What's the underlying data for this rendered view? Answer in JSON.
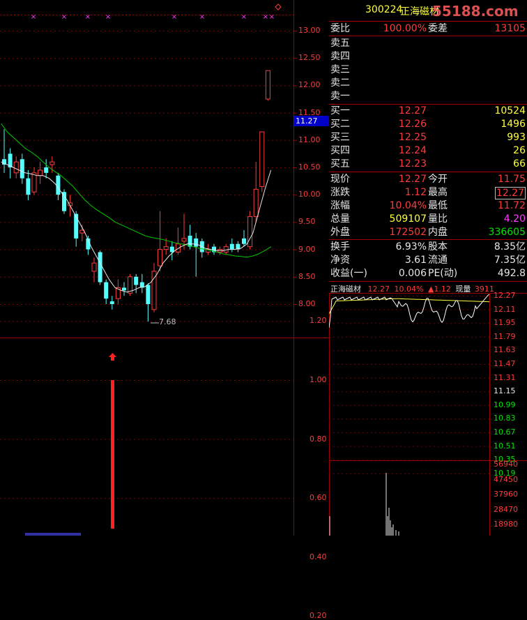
{
  "header": {
    "code": "300224",
    "name": "正海磁材",
    "watermark": "55188.com"
  },
  "colors": {
    "up": "#ff3c3c",
    "down": "#54ffff",
    "ma_fast": "#e6e6e6",
    "ma_slow": "#00c800",
    "price": "#ffff3c",
    "volume": "#00e600",
    "grid": "#800000"
  },
  "weibi": {
    "label1": "委比",
    "val1": "100.00%",
    "label2": "委差",
    "val2": "13105"
  },
  "sell": [
    {
      "label": "卖五"
    },
    {
      "label": "卖四"
    },
    {
      "label": "卖三"
    },
    {
      "label": "卖二"
    },
    {
      "label": "卖一"
    }
  ],
  "buy": [
    {
      "label": "买一",
      "price": "12.27",
      "vol": "10524"
    },
    {
      "label": "买二",
      "price": "12.26",
      "vol": "1496"
    },
    {
      "label": "买三",
      "price": "12.25",
      "vol": "993"
    },
    {
      "label": "买四",
      "price": "12.24",
      "vol": "26"
    },
    {
      "label": "买五",
      "price": "12.23",
      "vol": "66"
    }
  ],
  "stats": [
    {
      "l1": "现价",
      "v1": "12.27",
      "l2": "今开",
      "v2": "11.75"
    },
    {
      "l1": "涨跌",
      "v1": "1.12",
      "l2": "最高",
      "v2": "12.27"
    },
    {
      "l1": "涨幅",
      "v1": "10.04%",
      "l2": "最低",
      "v2": "11.72"
    },
    {
      "l1": "总量",
      "v1": "509107",
      "l2": "量比",
      "v2": "4.20"
    },
    {
      "l1": "外盘",
      "v1": "172502",
      "l2": "内盘",
      "v2": "336605"
    }
  ],
  "fin": [
    {
      "l1": "换手",
      "v1": "6.93%",
      "l2": "股本",
      "v2": "8.35亿"
    },
    {
      "l1": "净资",
      "v1": "3.61",
      "l2": "流通",
      "v2": "7.35亿"
    },
    {
      "l1": "收益(一)",
      "v1": "0.006",
      "l2": "PE(动)",
      "v2": "492.8"
    }
  ],
  "mini": {
    "name": "正海磁材",
    "price": "12.27",
    "pct": "10.04%",
    "chg": "▲1.12",
    "now_label": "现量",
    "now_vol": "3911",
    "price_ticks": [
      "12.27",
      "12.11",
      "11.95",
      "11.79",
      "11.63",
      "11.47",
      "11.31",
      "11.15",
      "10.99",
      "10.83",
      "10.67",
      "10.51",
      "10.35",
      "10.19"
    ],
    "vol_ticks": [
      "56940",
      "47450",
      "37960",
      "28470",
      "18980"
    ]
  },
  "kline": {
    "price_ticks": [
      "13.00",
      "12.50",
      "12.00",
      "11.50",
      "11.00",
      "10.50",
      "10.00",
      "9.50",
      "9.00",
      "8.50",
      "8.00"
    ],
    "current_price_tag": "11.27",
    "low_annotation": "7.68",
    "ind_ticks": [
      "1.20",
      "1.00",
      "0.80",
      "0.60",
      "0.40",
      "0.20"
    ],
    "marker_icon": "diamond-icon"
  },
  "chart_data": {
    "type": "candlestick",
    "ylim": [
      7.5,
      13.3
    ],
    "candles": [
      {
        "o": 10.65,
        "c": 10.55,
        "h": 11.2,
        "l": 10.4
      },
      {
        "o": 10.75,
        "c": 10.5,
        "h": 10.85,
        "l": 10.3
      },
      {
        "o": 10.4,
        "c": 10.6,
        "h": 10.7,
        "l": 10.3
      },
      {
        "o": 10.65,
        "c": 10.3,
        "h": 10.75,
        "l": 10.2
      },
      {
        "o": 10.3,
        "c": 10.0,
        "h": 10.45,
        "l": 9.9
      },
      {
        "o": 10.05,
        "c": 10.4,
        "h": 10.5,
        "l": 10.0
      },
      {
        "o": 10.35,
        "c": 10.45,
        "h": 10.6,
        "l": 10.2
      },
      {
        "o": 10.5,
        "c": 10.4,
        "h": 10.65,
        "l": 10.3
      },
      {
        "o": 10.55,
        "c": 10.6,
        "h": 10.7,
        "l": 10.4
      },
      {
        "o": 10.35,
        "c": 10.0,
        "h": 10.4,
        "l": 9.9
      },
      {
        "o": 10.05,
        "c": 9.7,
        "h": 10.1,
        "l": 9.65
      },
      {
        "o": 9.8,
        "c": 9.85,
        "h": 10.0,
        "l": 9.6
      },
      {
        "o": 9.65,
        "c": 9.2,
        "h": 9.7,
        "l": 9.05
      },
      {
        "o": 9.3,
        "c": 9.35,
        "h": 9.45,
        "l": 9.15
      },
      {
        "o": 9.2,
        "c": 9.0,
        "h": 9.25,
        "l": 8.9
      },
      {
        "o": 8.6,
        "c": 8.75,
        "h": 8.85,
        "l": 8.4
      },
      {
        "o": 8.95,
        "c": 8.4,
        "h": 8.98,
        "l": 8.35
      },
      {
        "o": 8.4,
        "c": 8.1,
        "h": 8.45,
        "l": 8.0
      },
      {
        "o": 8.05,
        "c": 8.0,
        "h": 8.15,
        "l": 7.9
      },
      {
        "o": 8.1,
        "c": 8.3,
        "h": 8.45,
        "l": 8.0
      },
      {
        "o": 8.3,
        "c": 8.25,
        "h": 8.4,
        "l": 8.15
      },
      {
        "o": 8.2,
        "c": 8.5,
        "h": 8.55,
        "l": 8.15
      },
      {
        "o": 8.5,
        "c": 8.35,
        "h": 8.55,
        "l": 8.2
      },
      {
        "o": 8.4,
        "c": 8.3,
        "h": 8.55,
        "l": 8.2
      },
      {
        "o": 8.35,
        "c": 8.0,
        "h": 8.38,
        "l": 7.68
      },
      {
        "o": 7.9,
        "c": 8.6,
        "h": 8.75,
        "l": 7.85
      },
      {
        "o": 8.7,
        "c": 9.0,
        "h": 9.7,
        "l": 8.6
      },
      {
        "o": 9.0,
        "c": 9.05,
        "h": 9.2,
        "l": 8.9
      },
      {
        "o": 9.05,
        "c": 8.95,
        "h": 9.15,
        "l": 8.8
      },
      {
        "o": 8.95,
        "c": 9.1,
        "h": 9.4,
        "l": 8.9
      },
      {
        "o": 9.15,
        "c": 9.2,
        "h": 9.65,
        "l": 9.0
      },
      {
        "o": 9.25,
        "c": 9.05,
        "h": 9.45,
        "l": 9.0
      },
      {
        "o": 9.2,
        "c": 9.05,
        "h": 9.3,
        "l": 8.5
      },
      {
        "o": 9.15,
        "c": 8.95,
        "h": 9.2,
        "l": 8.85
      },
      {
        "o": 8.95,
        "c": 9.0,
        "h": 9.1,
        "l": 8.9
      },
      {
        "o": 9.05,
        "c": 8.95,
        "h": 9.1,
        "l": 8.9
      },
      {
        "o": 8.95,
        "c": 9.0,
        "h": 9.05,
        "l": 8.9
      },
      {
        "o": 8.95,
        "c": 9.05,
        "h": 9.1,
        "l": 8.9
      },
      {
        "o": 9.1,
        "c": 9.0,
        "h": 9.2,
        "l": 8.95
      },
      {
        "o": 9.1,
        "c": 9.0,
        "h": 9.15,
        "l": 8.95
      },
      {
        "o": 9.2,
        "c": 9.1,
        "h": 9.35,
        "l": 9.05
      },
      {
        "o": 9.05,
        "c": 9.6,
        "h": 9.7,
        "l": 9.0
      },
      {
        "o": 9.6,
        "c": 10.1,
        "h": 10.6,
        "l": 9.5
      },
      {
        "o": 10.15,
        "c": 11.15,
        "h": 11.15,
        "l": 10.05
      },
      {
        "o": 11.75,
        "c": 12.27,
        "h": 12.27,
        "l": 11.72
      }
    ],
    "ma_fast": [
      10.6,
      10.55,
      10.5,
      10.45,
      10.4,
      10.38,
      10.35,
      10.35,
      10.3,
      10.2,
      10.05,
      9.9,
      9.7,
      9.5,
      9.3,
      9.05,
      8.85,
      8.65,
      8.45,
      8.3,
      8.25,
      8.22,
      8.25,
      8.3,
      8.32,
      8.4,
      8.55,
      8.75,
      8.88,
      8.98,
      9.05,
      9.1,
      9.1,
      9.08,
      9.02,
      9.0,
      8.98,
      8.98,
      9.0,
      9.0,
      9.02,
      9.1,
      9.3,
      9.7,
      10.1,
      10.45
    ],
    "ma_slow": [
      11.3,
      11.15,
      11.05,
      10.95,
      10.85,
      10.78,
      10.7,
      10.6,
      10.5,
      10.42,
      10.35,
      10.25,
      10.15,
      10.02,
      9.9,
      9.8,
      9.72,
      9.65,
      9.58,
      9.5,
      9.45,
      9.4,
      9.35,
      9.3,
      9.25,
      9.22,
      9.2,
      9.18,
      9.15,
      9.12,
      9.1,
      9.08,
      9.05,
      9.02,
      9.0,
      8.98,
      8.95,
      8.92,
      8.9,
      8.88,
      8.87,
      8.86,
      8.88,
      8.92,
      8.98,
      9.05
    ]
  }
}
